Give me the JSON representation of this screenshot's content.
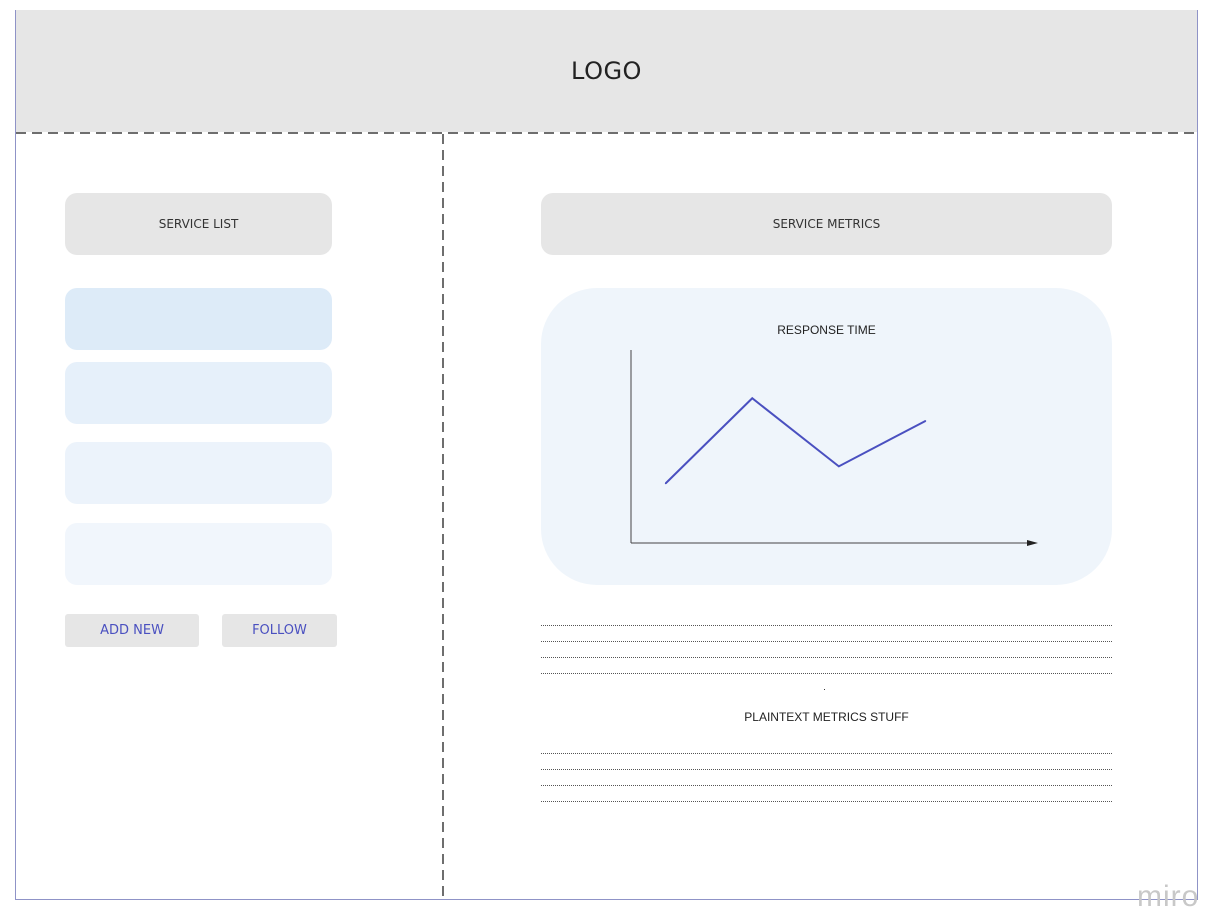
{
  "header": {
    "logo": "LOGO"
  },
  "left_panel": {
    "title": "SERVICE LIST",
    "items": [
      {
        "color": "#ddebf8"
      },
      {
        "color": "#e6f0fa"
      },
      {
        "color": "#ecf3fb"
      },
      {
        "color": "#f1f6fc"
      }
    ],
    "buttons": {
      "add_new": "ADD NEW",
      "follow": "FOLLOW"
    }
  },
  "right_panel": {
    "title": "SERVICE METRICS",
    "chart_data": {
      "type": "line",
      "title": "RESPONSE TIME",
      "xlabel": "",
      "ylabel": "",
      "x": [
        1,
        2,
        3,
        4
      ],
      "values": [
        2.1,
        5.1,
        2.7,
        4.3
      ],
      "ylim": [
        0,
        6.8
      ],
      "xlim": [
        0.6,
        5.3
      ],
      "grid": false,
      "series_color": "#4a50c0"
    },
    "plaintext_label": "PLAINTEXT METRICS STUFF"
  },
  "watermark": "miro"
}
